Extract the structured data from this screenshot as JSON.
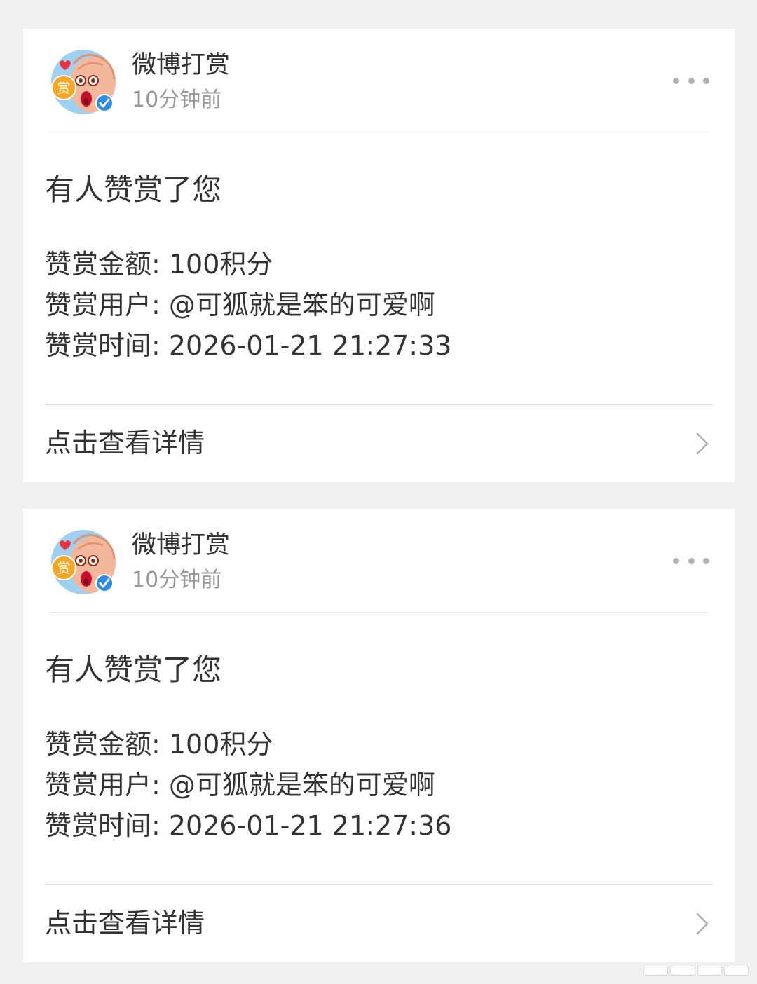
{
  "colors": {
    "background": "#f0f0f0",
    "card": "#ffffff",
    "text_primary": "#333333",
    "text_secondary": "#999999",
    "divider": "#e6e6e6",
    "verified_badge": "#2b8de8",
    "avatar_bg": "#9fd0f0",
    "avatar_coin": "#f5a623"
  },
  "notifications": [
    {
      "sender": {
        "name": "微博打赏",
        "time": "10分钟前",
        "avatar_icon": "reward-mascot-avatar",
        "avatar_coin_text": "赏",
        "verified": true
      },
      "title": "有人赞赏了您",
      "details": [
        "赞赏金额: 100积分",
        "赞赏用户: @可狐就是笨的可爱啊",
        "赞赏时间: 2026-01-21 21:27:33"
      ],
      "link_label": "点击查看详情"
    },
    {
      "sender": {
        "name": "微博打赏",
        "time": "10分钟前",
        "avatar_icon": "reward-mascot-avatar",
        "avatar_coin_text": "赏",
        "verified": true
      },
      "title": "有人赞赏了您",
      "details": [
        "赞赏金额: 100积分",
        "赞赏用户: @可狐就是笨的可爱啊",
        "赞赏时间: 2026-01-21 21:27:36"
      ],
      "link_label": "点击查看详情"
    }
  ]
}
